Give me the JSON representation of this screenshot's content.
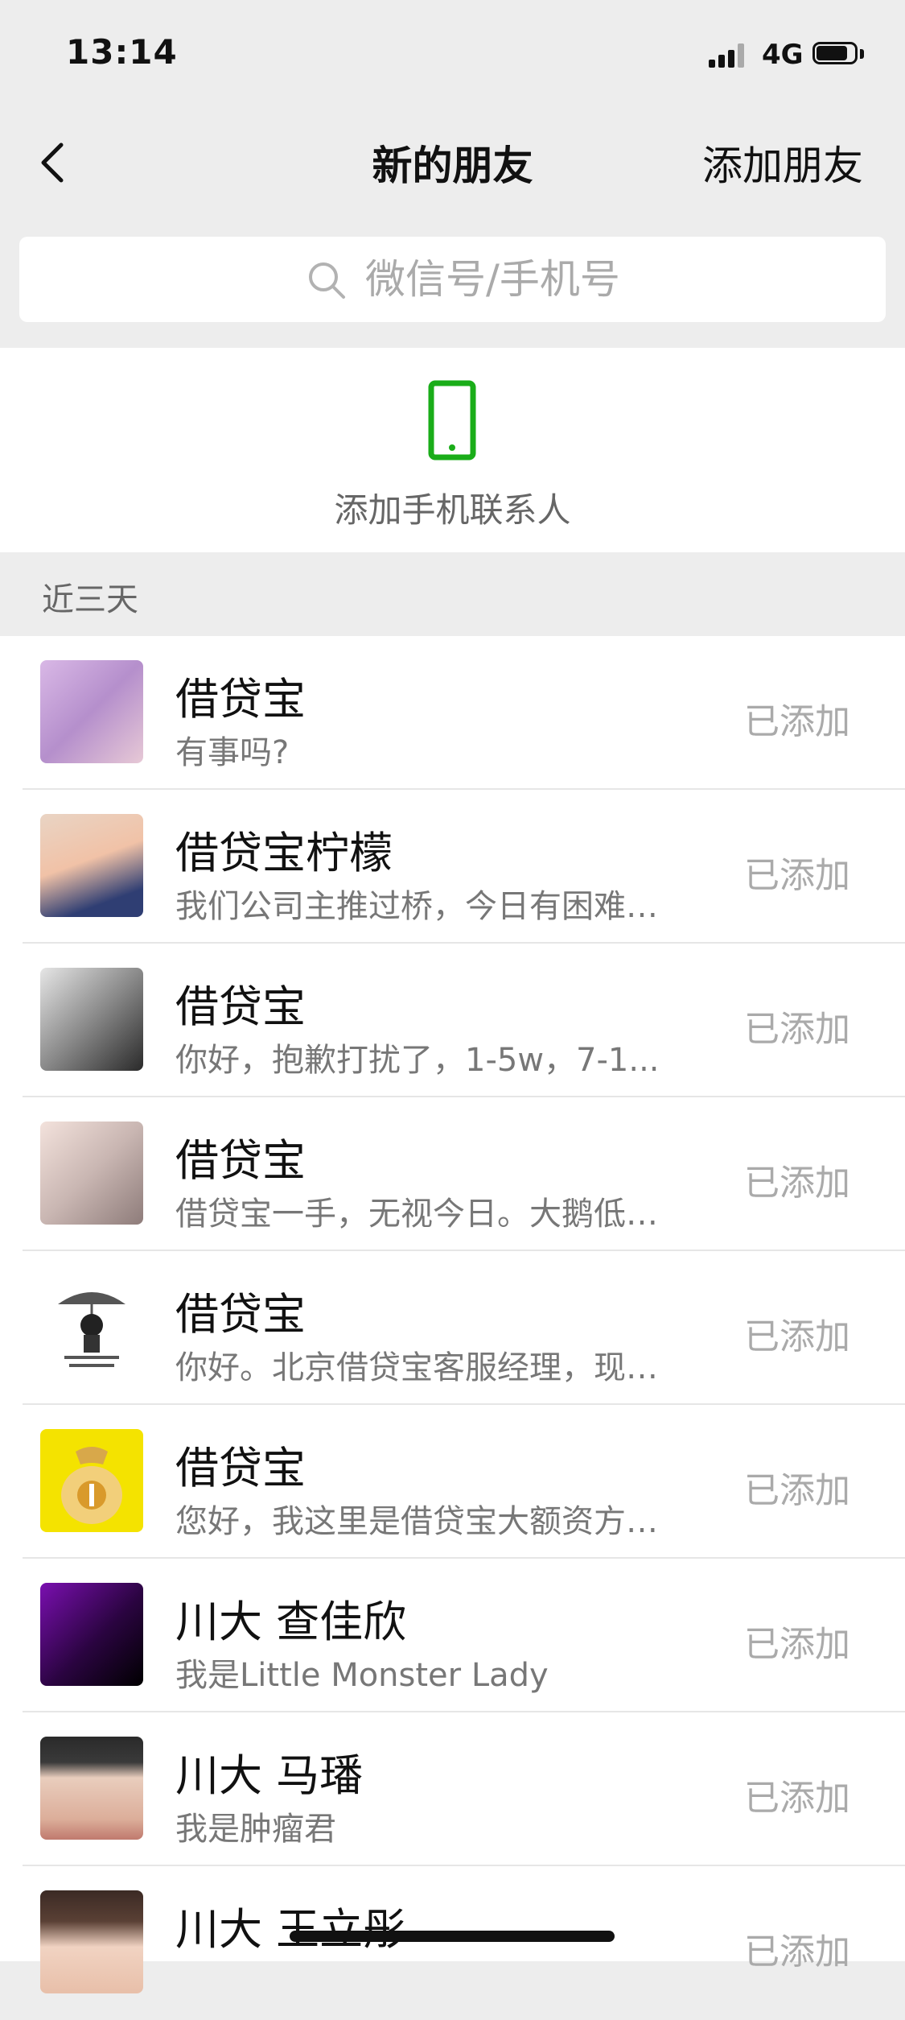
{
  "status_bar": {
    "time": "13:14",
    "network": "4G"
  },
  "nav": {
    "title": "新的朋友",
    "action": "添加朋友"
  },
  "search": {
    "placeholder": "微信号/手机号"
  },
  "phone_contacts": {
    "label": "添加手机联系人"
  },
  "section": {
    "label": "近三天"
  },
  "requests": [
    {
      "name": "借贷宝",
      "message": "有事吗?",
      "status": "已添加"
    },
    {
      "name": "借贷宝柠檬",
      "message": "我们公司主推过桥，今日有困难…",
      "status": "已添加"
    },
    {
      "name": "借贷宝",
      "message": "你好，抱歉打扰了，1-5w，7-1...",
      "status": "已添加"
    },
    {
      "name": "借贷宝",
      "message": "借贷宝一手，无视今日。大鹅低…",
      "status": "已添加"
    },
    {
      "name": "借贷宝",
      "message": "你好。北京借贷宝客服经理，现…",
      "status": "已添加"
    },
    {
      "name": "借贷宝",
      "message": "您好，我这里是借贷宝大额资方…",
      "status": "已添加"
    },
    {
      "name": "川大 查佳欣",
      "message": "我是Little Monster Lady",
      "status": "已添加"
    },
    {
      "name": "川大 马璠",
      "message": "我是肿瘤君",
      "status": "已添加"
    },
    {
      "name": "川大 王立彤",
      "message": "",
      "status": "已添加"
    }
  ],
  "colors": {
    "accent": "#1aad19",
    "background": "#ededed"
  }
}
